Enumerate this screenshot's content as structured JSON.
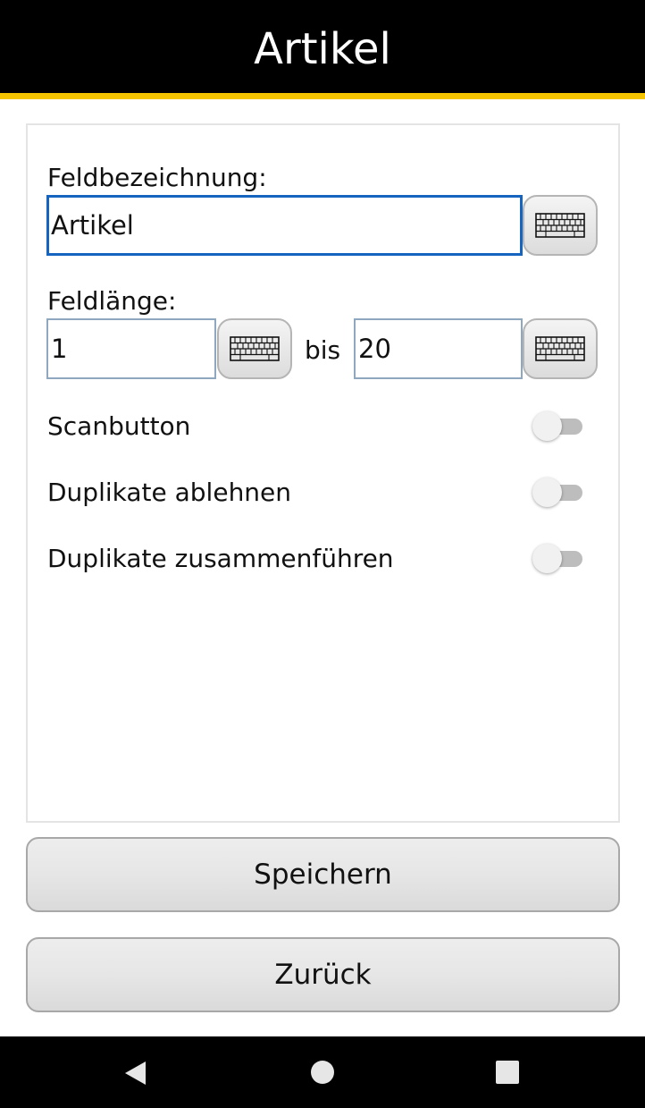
{
  "header": {
    "title": "Artikel"
  },
  "colors": {
    "header_bg": "#000000",
    "accent": "#f5c400",
    "focus_border": "#1565c0"
  },
  "form": {
    "field_name_label": "Feldbezeichnung:",
    "field_name_value": "Artikel",
    "field_length_label": "Feldlänge:",
    "length_min_value": "1",
    "length_separator": "bis",
    "length_max_value": "20",
    "toggles": [
      {
        "label": "Scanbutton",
        "on": false
      },
      {
        "label": "Duplikate ablehnen",
        "on": false
      },
      {
        "label": "Duplikate zusammenführen",
        "on": false
      }
    ]
  },
  "icons": {
    "keyboard": "keyboard-icon",
    "back": "nav-back-icon",
    "home": "nav-home-icon",
    "recent": "nav-recents-icon"
  },
  "buttons": {
    "save_label": "Speichern",
    "back_label": "Zurück"
  }
}
